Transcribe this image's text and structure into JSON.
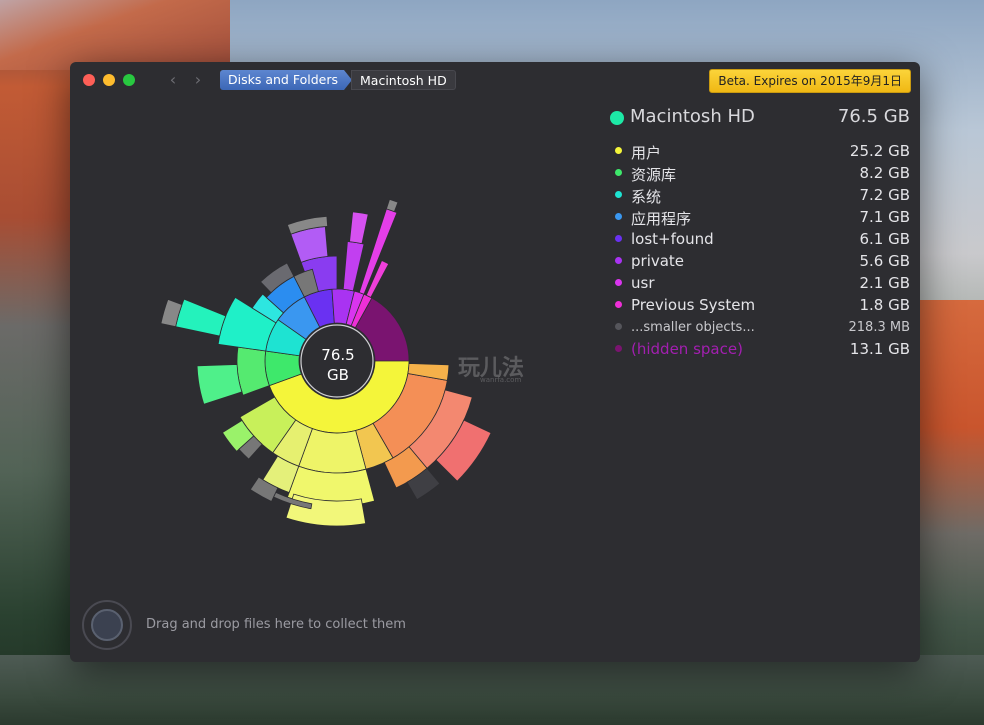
{
  "window": {
    "breadcrumbs": [
      "Disks and Folders",
      "Macintosh HD"
    ],
    "beta_label": "Beta. Expires on 2015年9月1日"
  },
  "center": {
    "value": "76.5",
    "unit": "GB"
  },
  "legend": {
    "header": {
      "name": "Macintosh HD",
      "size": "76.5 GB",
      "color": "#1de9a6"
    },
    "items": [
      {
        "name": "用户",
        "size": "25.2 GB",
        "color": "#f4f53a"
      },
      {
        "name": "资源库",
        "size": "8.2 GB",
        "color": "#3ee86b"
      },
      {
        "name": "系统",
        "size": "7.2 GB",
        "color": "#1ee3d2"
      },
      {
        "name": "应用程序",
        "size": "7.1 GB",
        "color": "#3a97f0"
      },
      {
        "name": "lost+found",
        "size": "6.1 GB",
        "color": "#6a31f2"
      },
      {
        "name": "private",
        "size": "5.6 GB",
        "color": "#a933f2"
      },
      {
        "name": "usr",
        "size": "2.1 GB",
        "color": "#d935ef"
      },
      {
        "name": "Previous System",
        "size": "1.8 GB",
        "color": "#ee2fd7"
      },
      {
        "name": "...smaller objects...",
        "size": "218.3  MB",
        "color": "#55555b"
      },
      {
        "name": "(hidden space)",
        "size": "13.1 GB",
        "color": "#7a1470"
      }
    ]
  },
  "watermark": {
    "text": "玩儿法",
    "sub": "wanrfa.com"
  },
  "drop_hint": "Drag and drop files here to collect them",
  "icons": [
    "chevron-left-icon",
    "chevron-right-icon",
    "collector-icon"
  ]
}
